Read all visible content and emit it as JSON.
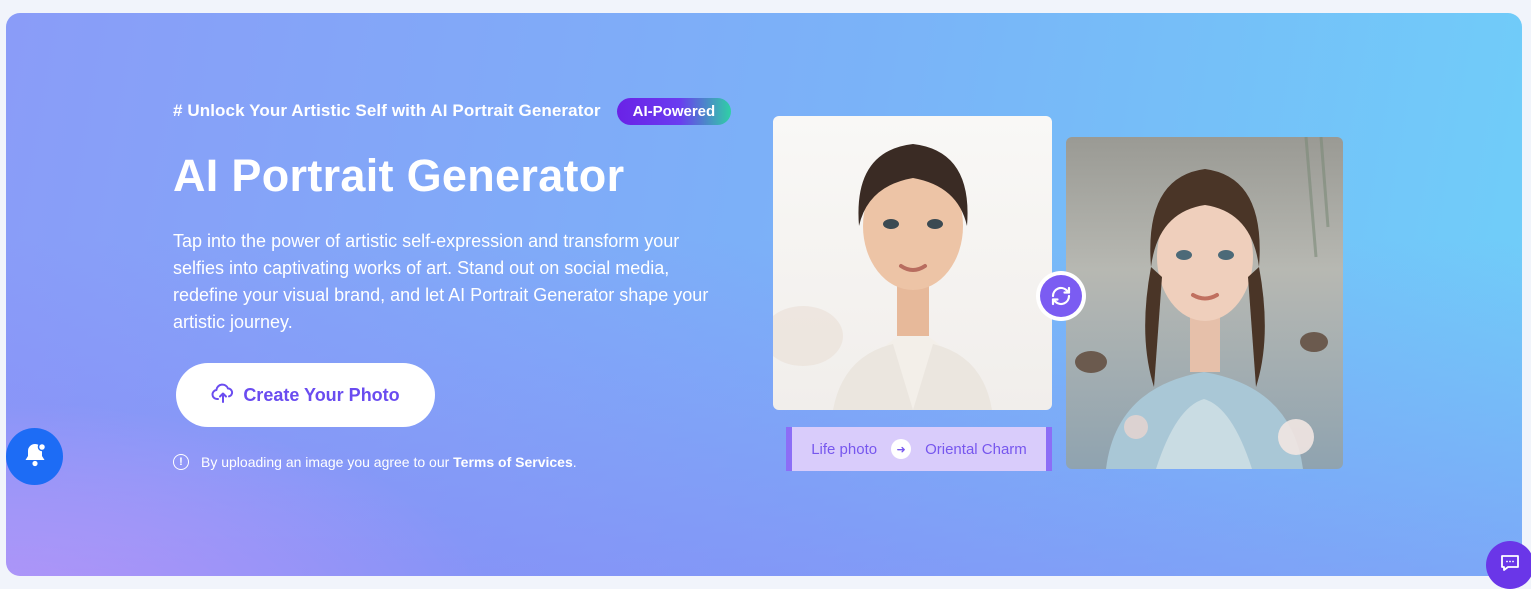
{
  "hero": {
    "tagline": "# Unlock Your Artistic Self with AI Portrait Generator",
    "badge": "AI-Powered",
    "title": "AI Portrait Generator",
    "description": "Tap into the power of artistic self-expression and transform your selfies into captivating works of art. Stand out on social media, redefine your visual brand, and let AI Portrait Generator shape your artistic journey.",
    "cta_label": "Create Your Photo",
    "note_prefix": "By uploading an image you agree to our ",
    "note_link": "Terms of Services",
    "note_suffix": "."
  },
  "preview": {
    "left_label": "Life photo",
    "right_label": "Oriental Charm",
    "left_image": "portrait of woman in white blouse",
    "right_image": "stylized portrait of woman in blue floral robe with birds"
  },
  "icons": {
    "upload": "cloud-upload-icon",
    "info": "info-circle-icon",
    "swap": "swap-refresh-icon",
    "arrow": "arrow-right-icon",
    "bell": "bell-icon",
    "chat": "chat-icon"
  },
  "colors": {
    "accent": "#6a4cf0",
    "bell_button": "#1d6cf5",
    "chat_button": "#6a36e8",
    "badge_start": "#6a22e6",
    "badge_end": "#2fd0a5"
  }
}
